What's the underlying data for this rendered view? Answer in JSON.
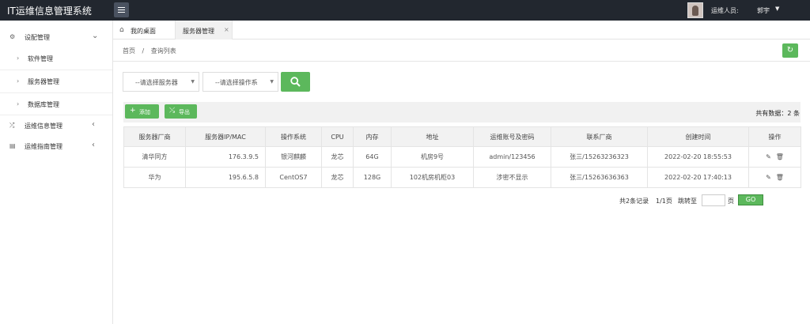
{
  "app": {
    "title": "IT运维信息管理系统"
  },
  "header": {
    "user_label": "运维人员:",
    "user_name": "郭宇"
  },
  "sidebar": {
    "items": [
      {
        "label": "设配管理"
      },
      {
        "label": "软件管理"
      },
      {
        "label": "服务器管理"
      },
      {
        "label": "数据库管理"
      },
      {
        "label": "运维信息管理"
      },
      {
        "label": "运维指南管理"
      }
    ]
  },
  "tabs": [
    {
      "label": "我的桌面"
    },
    {
      "label": "服务器管理"
    }
  ],
  "breadcrumb": {
    "home": "首页",
    "separator": "/",
    "current": "查询列表"
  },
  "filters": {
    "server_placeholder": "--请选择服务器",
    "os_placeholder": "--请选择操作系"
  },
  "toolbar": {
    "add_label": "添加",
    "export_label": "导出",
    "total_text": "共有数据：2 条"
  },
  "table": {
    "columns": [
      "服务器厂商",
      "服务器IP/MAC",
      "操作系统",
      "CPU",
      "内存",
      "地址",
      "运维账号及密码",
      "联系厂商",
      "创建时间",
      "操作"
    ],
    "rows": [
      {
        "vendor": "清华同方",
        "ip": "176.3.9.5",
        "os": "银河麒麟",
        "cpu": "龙芯",
        "memory": "64G",
        "address": "机房9号",
        "account": "admin/123456",
        "contact": "张三/15263236323",
        "created": "2022-02-20 18:55:53"
      },
      {
        "vendor": "华为",
        "ip": "195.6.5.8",
        "os": "CentOS7",
        "cpu": "龙芯",
        "memory": "128G",
        "address": "102机房机柜03",
        "account": "涉密不显示",
        "contact": "张三/15263636363",
        "created": "2022-02-20 17:40:13"
      }
    ]
  },
  "pager": {
    "summary": "共2条记录",
    "page_info": "1/1页",
    "jump_label": "跳转至",
    "page_unit": "页",
    "go_label": "GO"
  },
  "colors": {
    "accent_green": "#5cb85c",
    "topbar": "#22272f"
  },
  "icons": {
    "settings": "settings-icon",
    "share": "share-icon",
    "book": "book-icon",
    "home": "home-icon",
    "refresh": "refresh-icon",
    "search": "search-icon",
    "edit": "edit-icon",
    "delete": "trash-icon"
  }
}
